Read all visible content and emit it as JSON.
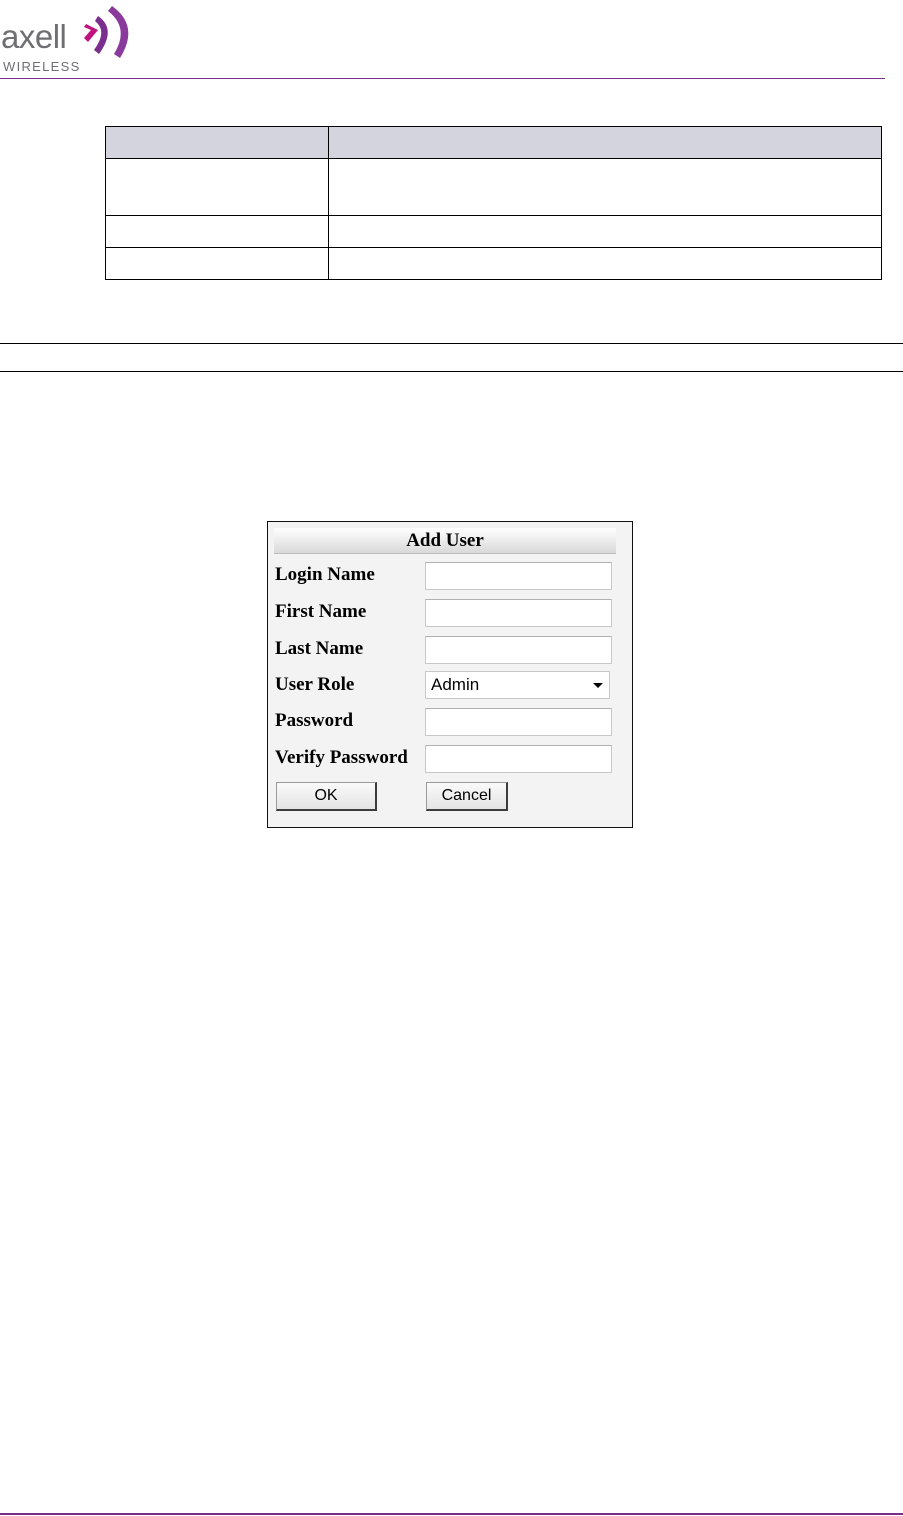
{
  "header": {
    "logo_word": "axell",
    "logo_sub": "WIRELESS"
  },
  "dialog": {
    "title": "Add User",
    "fields": {
      "login_name": {
        "label": "Login Name",
        "value": ""
      },
      "first_name": {
        "label": "First Name",
        "value": ""
      },
      "last_name": {
        "label": "Last Name",
        "value": ""
      },
      "user_role": {
        "label": "User Role",
        "value": "Admin"
      },
      "password": {
        "label": "Password",
        "value": ""
      },
      "verify_password": {
        "label": "Verify Password",
        "value": ""
      }
    },
    "ok_label": "OK",
    "cancel_label": "Cancel"
  },
  "colors": {
    "brand_purple": "#7a2f8f",
    "brand_magenta": "#c2127e",
    "table_header_bg": "#d4d4de"
  },
  "icons": [
    "axell-logo-chevrons-icon",
    "chevron-down-icon"
  ]
}
